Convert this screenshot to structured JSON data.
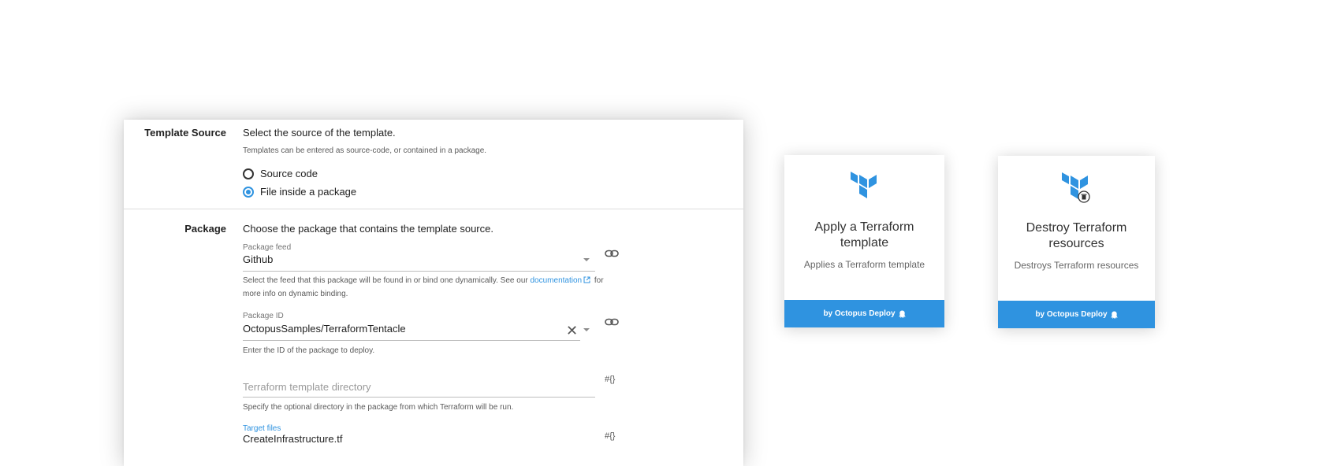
{
  "template_source": {
    "label": "Template Source",
    "description": "Select the source of the template.",
    "help": "Templates can be entered as source-code, or contained in a package.",
    "options": [
      {
        "label": "Source code",
        "selected": false
      },
      {
        "label": "File inside a package",
        "selected": true
      }
    ]
  },
  "package": {
    "label": "Package",
    "description": "Choose the package that contains the template source.",
    "feed": {
      "label": "Package feed",
      "value": "Github",
      "help_before": "Select the feed that this package will be found in or bind one dynamically. See our",
      "help_link": "documentation",
      "help_after": "for more info on dynamic binding."
    },
    "package_id": {
      "label": "Package ID",
      "value": "OctopusSamples/TerraformTentacle",
      "help": "Enter the ID of the package to deploy."
    },
    "template_dir": {
      "placeholder": "Terraform template directory",
      "help": "Specify the optional directory in the package from which Terraform will be run."
    },
    "target_files": {
      "label": "Target files",
      "value": "CreateInfrastructure.tf"
    },
    "bind_icon_text": "#{}"
  },
  "cards": [
    {
      "title": "Apply a Terraform template",
      "description": "Applies a Terraform template",
      "footer": "by Octopus Deploy"
    },
    {
      "title": "Destroy Terraform resources",
      "description": "Destroys Terraform resources",
      "footer": "by Octopus Deploy"
    }
  ],
  "colors": {
    "accent": "#2f93e0",
    "terraform_logo": "#2f93e0"
  }
}
